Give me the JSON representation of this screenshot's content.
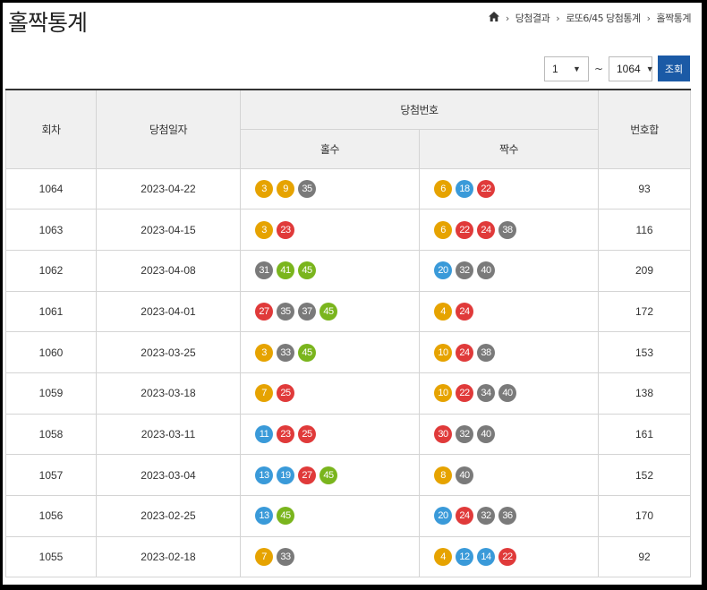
{
  "header": {
    "title": "홀짝통계"
  },
  "breadcrumb": {
    "items": [
      "당첨결과",
      "로또6/45 당첨통계",
      "홀짝통계"
    ]
  },
  "filter": {
    "from_value": "1",
    "tilde": "~",
    "to_value": "1064",
    "search_label": "조회"
  },
  "table": {
    "headers": {
      "round": "회차",
      "date": "당첨일자",
      "numbers": "당첨번호",
      "odd": "홀수",
      "even": "짝수",
      "sum": "번호합"
    },
    "rows": [
      {
        "round": "1064",
        "date": "2023-04-22",
        "odd": [
          "3",
          "9",
          "35"
        ],
        "even": [
          "6",
          "18",
          "22"
        ],
        "sum": "93"
      },
      {
        "round": "1063",
        "date": "2023-04-15",
        "odd": [
          "3",
          "23"
        ],
        "even": [
          "6",
          "22",
          "24",
          "38"
        ],
        "sum": "116"
      },
      {
        "round": "1062",
        "date": "2023-04-08",
        "odd": [
          "31",
          "41",
          "45"
        ],
        "even": [
          "20",
          "32",
          "40"
        ],
        "sum": "209"
      },
      {
        "round": "1061",
        "date": "2023-04-01",
        "odd": [
          "27",
          "35",
          "37",
          "45"
        ],
        "even": [
          "4",
          "24"
        ],
        "sum": "172"
      },
      {
        "round": "1060",
        "date": "2023-03-25",
        "odd": [
          "3",
          "33",
          "45"
        ],
        "even": [
          "10",
          "24",
          "38"
        ],
        "sum": "153"
      },
      {
        "round": "1059",
        "date": "2023-03-18",
        "odd": [
          "7",
          "25"
        ],
        "even": [
          "10",
          "22",
          "34",
          "40"
        ],
        "sum": "138"
      },
      {
        "round": "1058",
        "date": "2023-03-11",
        "odd": [
          "11",
          "23",
          "25"
        ],
        "even": [
          "30",
          "32",
          "40"
        ],
        "sum": "161"
      },
      {
        "round": "1057",
        "date": "2023-03-04",
        "odd": [
          "13",
          "19",
          "27",
          "45"
        ],
        "even": [
          "8",
          "40"
        ],
        "sum": "152"
      },
      {
        "round": "1056",
        "date": "2023-02-25",
        "odd": [
          "13",
          "45"
        ],
        "even": [
          "20",
          "24",
          "32",
          "36"
        ],
        "sum": "170"
      },
      {
        "round": "1055",
        "date": "2023-02-18",
        "odd": [
          "7",
          "33"
        ],
        "even": [
          "4",
          "12",
          "14",
          "22"
        ],
        "sum": "92"
      }
    ]
  },
  "ball_colors": {
    "1-10": "#e6a300",
    "11-20": "#3a9ad9",
    "21-30": "#e03a3a",
    "31-40": "#7a7a7a",
    "41-45": "#7ab51d"
  }
}
